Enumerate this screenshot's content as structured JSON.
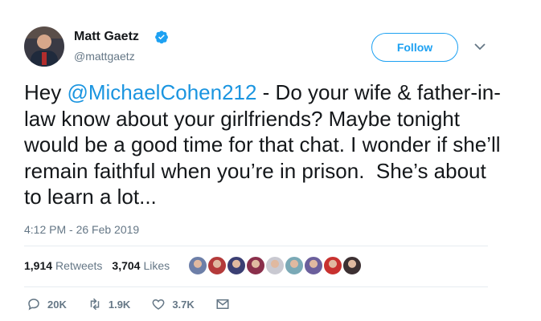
{
  "author": {
    "name": "Matt Gaetz",
    "handle": "@mattgaetz",
    "verified_icon": "verified-badge-icon"
  },
  "header": {
    "follow_label": "Follow",
    "more_icon": "chevron-down-icon"
  },
  "tweet": {
    "text_before": "Hey ",
    "mention": "@MichaelCohen212",
    "text_after": " - Do your wife & father-in-law know about your girlfriends? Maybe tonight would be a good time for that chat. I wonder if she’ll remain faithful when you’re in prison.  She’s about to learn a lot...",
    "timestamp": "4:12 PM - 26 Feb 2019"
  },
  "stats": {
    "retweets_count": "1,914",
    "retweets_label": "Retweets",
    "likes_count": "3,704",
    "likes_label": "Likes"
  },
  "likers": {
    "colors": [
      "#6d7fa8",
      "#b43a3a",
      "#3b3f73",
      "#8a2f4b",
      "#c9c9d1",
      "#7aa9b6",
      "#6b5f9c",
      "#c8312f",
      "#3c3032"
    ]
  },
  "actions": {
    "replies": "20K",
    "retweets": "1.9K",
    "likes": "3.7K"
  },
  "colors": {
    "accent": "#1da1f2",
    "mention": "#1b95e0",
    "muted": "#657786"
  }
}
